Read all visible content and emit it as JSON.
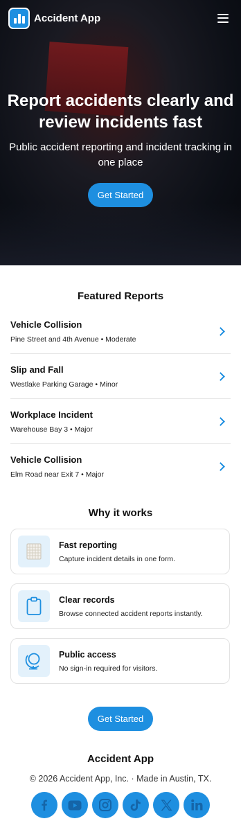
{
  "header": {
    "brand": "Accident App",
    "logo_icon": "bar-chart-icon",
    "menu_icon": "hamburger-menu-icon"
  },
  "hero": {
    "title": "Report accidents clearly and review incidents fast",
    "subtitle": "Public accident reporting and incident tracking in one place",
    "cta_label": "Get Started"
  },
  "featured": {
    "title": "Featured Reports",
    "items": [
      {
        "title": "Vehicle Collision",
        "meta": "Pine Street and 4th Avenue • Moderate"
      },
      {
        "title": "Slip and Fall",
        "meta": "Westlake Parking Garage • Minor"
      },
      {
        "title": "Workplace Incident",
        "meta": "Warehouse Bay 3 • Major"
      },
      {
        "title": "Vehicle Collision",
        "meta": "Elm Road near Exit 7 • Major"
      }
    ]
  },
  "why": {
    "title": "Why it works",
    "cards": [
      {
        "icon": "notepad-icon",
        "title": "Fast reporting",
        "desc": "Capture incident details in one form."
      },
      {
        "icon": "clipboard-icon",
        "title": "Clear records",
        "desc": "Browse connected accident reports instantly."
      },
      {
        "icon": "globe-icon",
        "title": "Public access",
        "desc": "No sign-in required for visitors."
      }
    ]
  },
  "cta": {
    "label": "Get Started"
  },
  "footer": {
    "brand": "Accident App",
    "copyright": "© 2026 Accident App, Inc. · Made in Austin, TX.",
    "socials": [
      "facebook-icon",
      "youtube-icon",
      "instagram-icon",
      "tiktok-icon",
      "x-icon",
      "linkedin-icon"
    ]
  },
  "colors": {
    "accent": "#1e8fe0",
    "icon_bg": "#e3f1fb",
    "hero_bg": "#0c0f16"
  }
}
